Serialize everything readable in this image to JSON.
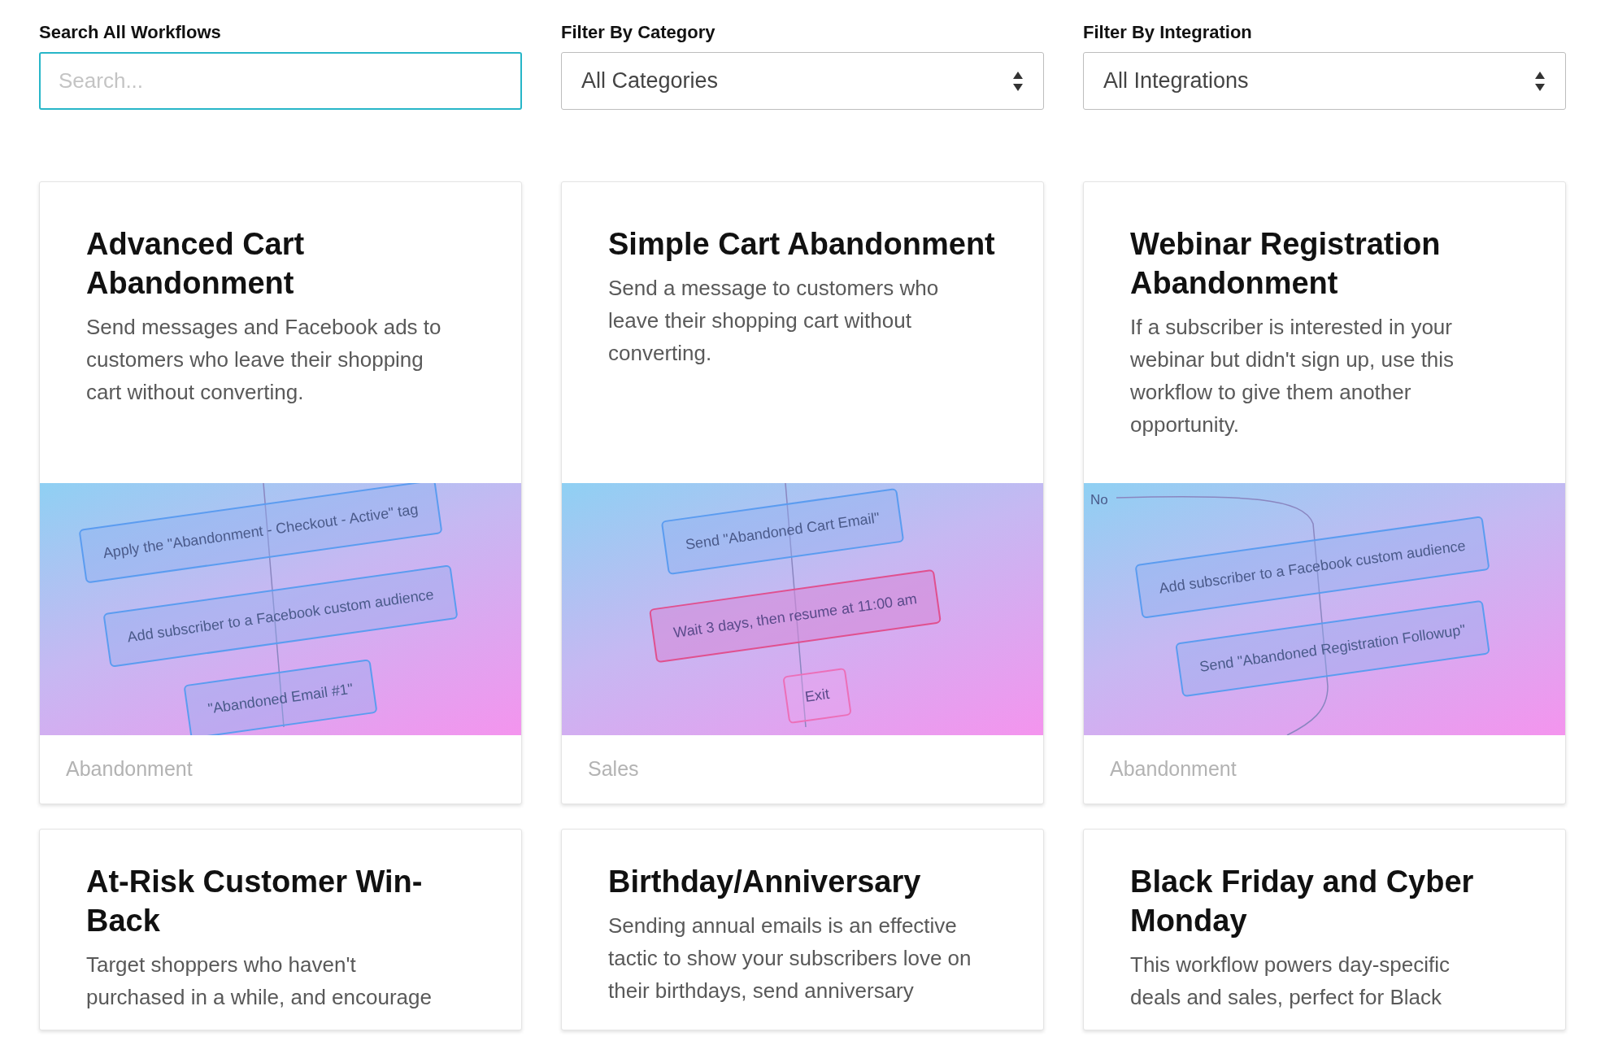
{
  "search": {
    "label": "Search All Workflows",
    "placeholder": "Search..."
  },
  "filters": [
    {
      "label": "Filter By Category",
      "value": "All Categories"
    },
    {
      "label": "Filter By Integration",
      "value": "All Integrations"
    }
  ],
  "workflows": [
    {
      "title": "Advanced Cart Abandonment",
      "description": "Send messages and Facebook ads to customers who leave their shopping cart without converting.",
      "diagram": {
        "nodes": [
          {
            "kind": "action",
            "text": "Apply the \"Abandonment - Checkout - Active\" tag"
          },
          {
            "kind": "action",
            "text": "Add subscriber to a Facebook custom audience"
          },
          {
            "kind": "action",
            "text": "\"Abandoned Email #1\""
          }
        ]
      },
      "category": "Abandonment"
    },
    {
      "title": "Simple Cart Abandonment",
      "description": "Send a message to customers who leave their shopping cart without converting.",
      "diagram": {
        "nodes": [
          {
            "kind": "action",
            "text": "Send \"Abandoned Cart Email\""
          },
          {
            "kind": "wait",
            "text": "Wait 3 days, then resume at 11:00 am"
          },
          {
            "kind": "exit",
            "text": "Exit"
          }
        ]
      },
      "category": "Sales"
    },
    {
      "title": "Webinar Registration Abandonment",
      "description": "If a subscriber is interested in your webinar but didn't sign up, use this workflow to give them another opportunity.",
      "diagram": {
        "branch_label": "No",
        "nodes": [
          {
            "kind": "action",
            "text": "Add subscriber to a Facebook custom audience"
          },
          {
            "kind": "action",
            "text": "Send \"Abandoned Registration Followup\""
          }
        ]
      },
      "category": "Abandonment"
    },
    {
      "title": "At-Risk Customer Win-Back",
      "description": "Target shoppers who haven't purchased in a while, and encourage"
    },
    {
      "title": "Birthday/Anniversary",
      "description": "Sending annual emails is an effective tactic to show your subscribers love on their birthdays, send anniversary"
    },
    {
      "title": "Black Friday and Cyber Monday",
      "description": "This workflow powers day-specific deals and sales, perfect for Black"
    }
  ]
}
